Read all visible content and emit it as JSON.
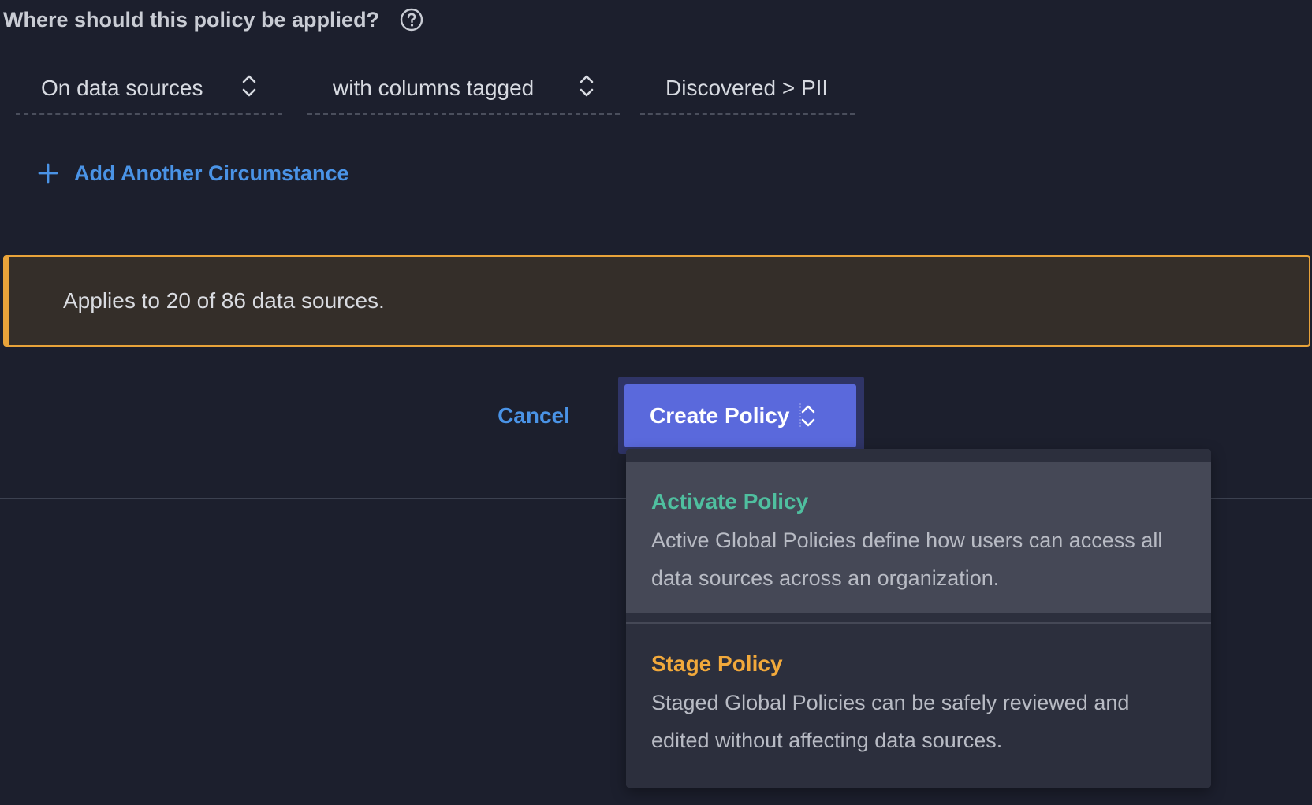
{
  "question": {
    "text": "Where should this policy be applied?"
  },
  "circumstance": {
    "scope_select": "On data sources",
    "condition_select": "with columns tagged",
    "tag_value": "Discovered > PII"
  },
  "add_circumstance": {
    "label": "Add Another Circumstance"
  },
  "banner": {
    "text": "Applies to 20 of 86 data sources."
  },
  "actions": {
    "cancel_label": "Cancel",
    "create_label": "Create Policy"
  },
  "create_menu": {
    "items": [
      {
        "title": "Activate Policy",
        "description": "Active Global Policies define how users can access all data sources across an organization."
      },
      {
        "title": "Stage Policy",
        "description": "Staged Global Policies can be safely reviewed and edited without affecting data sources."
      }
    ]
  },
  "colors": {
    "background": "#1c1f2d",
    "link_blue": "#4a93e6",
    "primary_button": "#5a69dc",
    "warning_border": "#e8a33a",
    "warning_background": "#342e29",
    "activate_title": "#4fbf9f",
    "stage_title": "#f2a93b"
  },
  "icons": {
    "help": "question-circle-icon",
    "select_chevron": "chevron-up-down-icon",
    "add": "plus-icon"
  }
}
